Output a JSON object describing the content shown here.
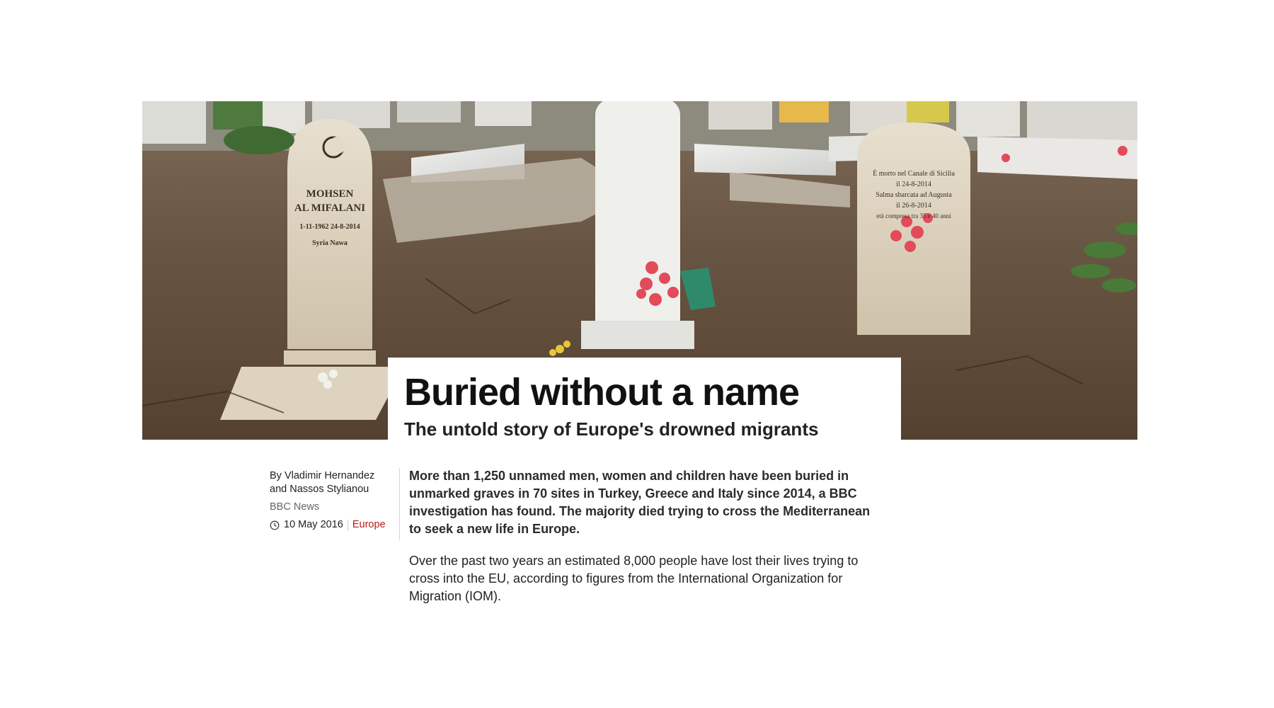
{
  "hero": {
    "image_icon": "cemetery-photo",
    "headstones": {
      "left": {
        "lines": [
          "MOHSEN",
          "AL MIFALANI",
          "1-11-1962   24-8-2014",
          "Syria Nawa"
        ]
      },
      "right": {
        "lines": [
          "È morto nel Canale di Sicilia",
          "il 24-8-2014",
          "Salma sbarcata ad Augusta",
          "il 26-8-2014",
          "età compresa tra 35 e 40 anni"
        ]
      }
    }
  },
  "article": {
    "title": "Buried without a name",
    "subtitle": "The untold story of Europe's drowned migrants",
    "byline_line1": "By Vladimir Hernandez",
    "byline_line2": "and Nassos Stylianou",
    "organisation": "BBC News",
    "date": "10 May 2016",
    "section": "Europe",
    "intro": "More than 1,250 unnamed men, women and children have been buried in unmarked graves in 70 sites in Turkey, Greece and Italy since 2014, a BBC investigation has found. The majority died trying to cross the Mediterranean to seek a new life in Europe.",
    "paragraph_1": "Over the past two years an estimated 8,000 people have lost their lives trying to cross into the EU, according to figures from the International Organization for Migration (IOM)."
  },
  "colors": {
    "section_link": "#bb1919",
    "divider": "#d6d6d6"
  }
}
